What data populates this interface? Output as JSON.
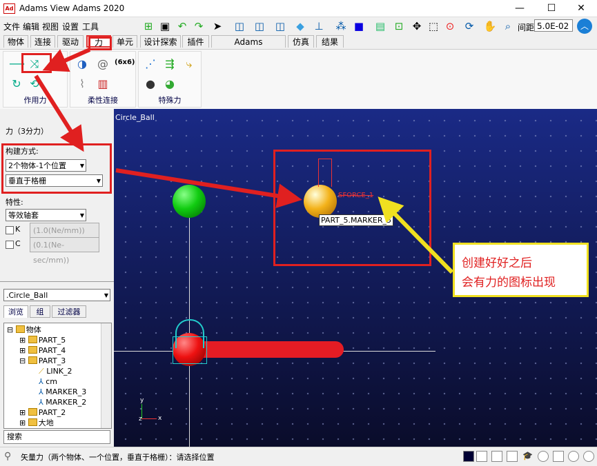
{
  "window": {
    "title": "Adams View Adams 2020",
    "app_icon": "Ad",
    "minimize": "—",
    "maximize": "☐",
    "close": "✕"
  },
  "menu": [
    "文件",
    "编辑",
    "视图",
    "设置",
    "工具"
  ],
  "toolbar": {
    "zoom_label": "间距",
    "zoom_value": "5.0E-02"
  },
  "tabs": [
    "物体",
    "连接",
    "驱动",
    "力",
    "单元",
    "设计探索",
    "插件",
    "Adams Machinery",
    "仿真",
    "结果"
  ],
  "active_tab": "力",
  "ribbon": {
    "groups": [
      {
        "label": "作用力"
      },
      {
        "label": "柔性连接",
        "text_button": "(6x6)"
      },
      {
        "label": "特殊力"
      }
    ]
  },
  "panel": {
    "title": "力（3分力）",
    "construction_label": "构建方式:",
    "construction_value": "2个物体-1个位置",
    "orientation_value": "垂直于格栅",
    "property_label": "特性:",
    "property_value": "等效轴套",
    "k_label": "K",
    "k_value": "(1.0(Ne/mm))",
    "c_label": "C",
    "c_value": "(0.1(Ne-sec/mm))"
  },
  "browser": {
    "model": ".Circle_Ball",
    "tabs": [
      "浏览",
      "组",
      "过滤器"
    ],
    "tree": [
      "物体",
      "PART_5",
      "PART_4",
      "PART_3",
      "LINK_2",
      "cm",
      "MARKER_3",
      "MARKER_2",
      "PART_2",
      "大地"
    ],
    "search": "搜索"
  },
  "viewport": {
    "model_name": "Circle_Ball",
    "tooltip": "PART_5.MARKER_5",
    "force_label": "SFORCE_1",
    "axis_y": "y",
    "axis_z": "z",
    "axis_x": "x"
  },
  "annotation": {
    "line1": "创建好好之后",
    "line2": "会有力的图标出现"
  },
  "status": {
    "text": "矢量力（两个物体、一个位置，垂直于格栅）：请选择位置"
  },
  "colors": {
    "highlight": "#e02020",
    "callout": "#f0e020",
    "viewport_top": "#1a2a86",
    "viewport_bottom": "#0a0c2a"
  }
}
